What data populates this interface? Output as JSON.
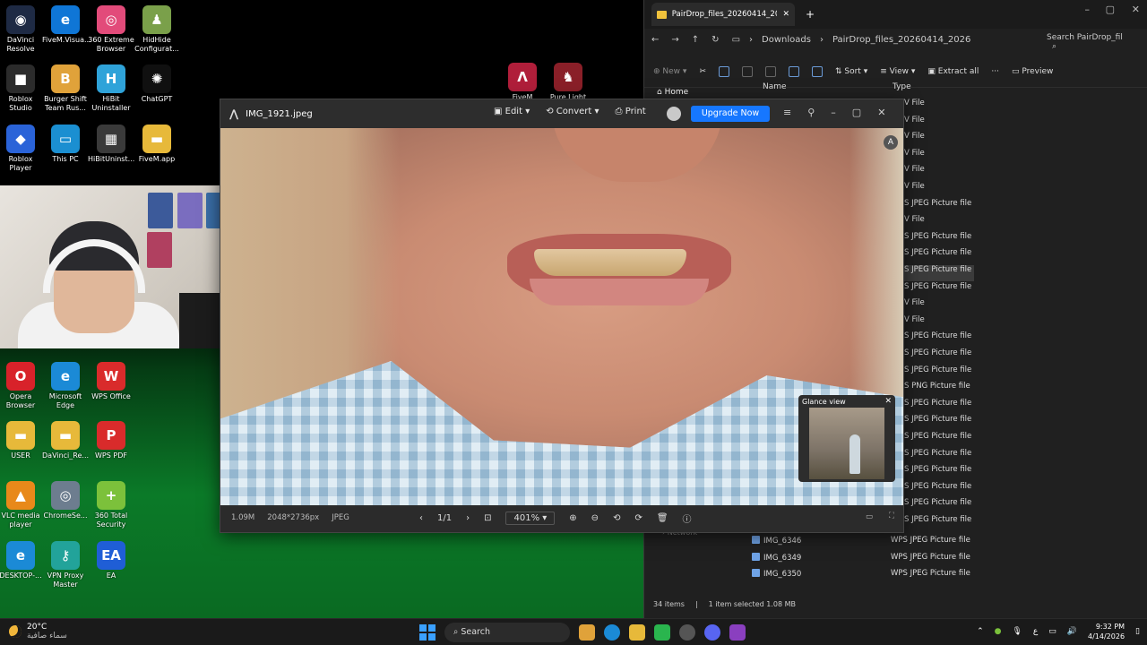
{
  "desktop": {
    "icons_top": [
      {
        "label": "DaVinci Resolve",
        "color": "#1e2a44",
        "glyph": "◉"
      },
      {
        "label": "FiveM.Visua...",
        "color": "#0f76d6",
        "glyph": "e"
      },
      {
        "label": "360 Extreme Browser",
        "color": "#e24b7a",
        "glyph": "◎"
      },
      {
        "label": "HidHide Configurat...",
        "color": "#7aa04a",
        "glyph": "♟"
      },
      {
        "label": "Roblox Studio",
        "color": "#2b2b2b",
        "glyph": "■"
      },
      {
        "label": "Burger Shift Team Rus...",
        "color": "#e0a23a",
        "glyph": "B"
      },
      {
        "label": "HiBit Uninstaller",
        "color": "#2fa3d9",
        "glyph": "H"
      },
      {
        "label": "ChatGPT",
        "color": "#101010",
        "glyph": "✺"
      },
      {
        "label": "Roblox Player",
        "color": "#2a63d8",
        "glyph": "◆"
      },
      {
        "label": "This PC",
        "color": "#1b8fd1",
        "glyph": "▭"
      },
      {
        "label": "HiBitUninst...",
        "color": "#3a3a3a",
        "glyph": "▦"
      },
      {
        "label": "FiveM.app",
        "color": "#e7b93a",
        "glyph": "▬"
      }
    ],
    "icons_bottom": [
      {
        "label": "Opera Browser",
        "color": "#d8222a",
        "glyph": "O"
      },
      {
        "label": "Microsoft Edge",
        "color": "#1b8ad6",
        "glyph": "e"
      },
      {
        "label": "WPS Office",
        "color": "#d92b2b",
        "glyph": "W"
      },
      {
        "label": "USER",
        "color": "#e7b93a",
        "glyph": "▬"
      },
      {
        "label": "DaVinci_Re...",
        "color": "#e7b93a",
        "glyph": "▬"
      },
      {
        "label": "WPS PDF",
        "color": "#d92b2b",
        "glyph": "P"
      },
      {
        "label": "VLC media player",
        "color": "#e8891a",
        "glyph": "▲"
      },
      {
        "label": "ChromeSe...",
        "color": "#6d7d8f",
        "glyph": "◎"
      },
      {
        "label": "360 Total Security",
        "color": "#7cc13b",
        "glyph": "+"
      },
      {
        "label": "DESKTOP-...",
        "color": "#1b8ad6",
        "glyph": "e"
      },
      {
        "label": "VPN Proxy Master",
        "color": "#22a39a",
        "glyph": "⚷"
      },
      {
        "label": "EA",
        "color": "#1f5ed6",
        "glyph": "EA"
      }
    ],
    "mid_icons": [
      {
        "label": "FiveM",
        "color": "#b01e3a",
        "glyph": "Λ"
      },
      {
        "label": "Pure Light",
        "color": "#8a1f28",
        "glyph": "♞"
      }
    ]
  },
  "explorer": {
    "tab_title": "PairDrop_files_20260414_2026",
    "breadcrumbs": [
      "Downloads",
      "PairDrop_files_20260414_2026"
    ],
    "search_placeholder": "Search PairDrop_fil",
    "commands": {
      "new": "New",
      "sort": "Sort",
      "view": "View",
      "extract": "Extract all",
      "preview": "Preview"
    },
    "nav_home": "Home",
    "nav_network": "Network",
    "columns": {
      "name": "Name",
      "type": "Type"
    },
    "type_rows": [
      "V File",
      "V File",
      "V File",
      "V File",
      "V File",
      "V File",
      "S JPEG Picture file",
      "V File",
      "S JPEG Picture file",
      "S JPEG Picture file",
      "S JPEG Picture file",
      "S JPEG Picture file",
      "V File",
      "V File",
      "S JPEG Picture file",
      "S JPEG Picture file",
      "S JPEG Picture file",
      "S PNG Picture file",
      "S JPEG Picture file",
      "S JPEG Picture file",
      "S JPEG Picture file",
      "S JPEG Picture file",
      "S JPEG Picture file",
      "S JPEG Picture file",
      "S JPEG Picture file",
      "S JPEG Picture file"
    ],
    "selected_type_index": 10,
    "files": [
      {
        "name": "IMG_6346",
        "type": "WPS JPEG Picture file"
      },
      {
        "name": "IMG_6349",
        "type": "WPS JPEG Picture file"
      },
      {
        "name": "IMG_6350",
        "type": "WPS JPEG Picture file"
      }
    ],
    "status": {
      "items": "34 items",
      "selected": "1 item selected  1.08 MB"
    }
  },
  "viewer": {
    "title": "IMG_1921.jpeg",
    "actions": {
      "edit": "Edit",
      "convert": "Convert",
      "print": "Print"
    },
    "upgrade": "Upgrade Now",
    "glance_title": "Glance view",
    "meta": {
      "size": "1.09M",
      "dimensions": "2048*2736px",
      "format": "JPEG"
    },
    "page": "1/1",
    "zoom": "401%"
  },
  "taskbar": {
    "weather_temp": "20°C",
    "weather_desc": "سماء صافية",
    "search": "Search",
    "time": "9:32 PM",
    "date": "4/14/2026",
    "lang": "ع"
  }
}
